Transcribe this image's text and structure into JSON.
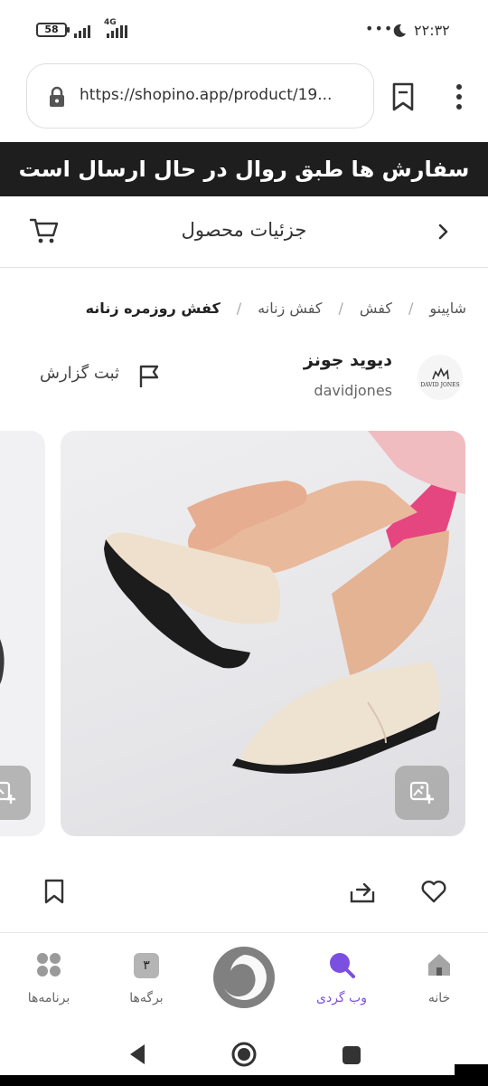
{
  "status_bar": {
    "battery": "58",
    "network": "4G",
    "time": "۲۲:۳۲",
    "dots": "•••"
  },
  "browser": {
    "url": "https://shopino.app/product/19..."
  },
  "banner": {
    "text": "سفارش ها طبق روال در حال ارسال است"
  },
  "header": {
    "title": "جزئیات محصول"
  },
  "breadcrumb": {
    "items": [
      "شاپینو",
      "کفش",
      "کفش زنانه",
      "کفش روزمره زنانه"
    ],
    "separator": "/"
  },
  "brand": {
    "name": "دیوید جونز",
    "handle": "davidjones",
    "logo_text": "DAVID JONES"
  },
  "report": {
    "label": "ثبت گزارش"
  },
  "bottom_nav": {
    "items": [
      {
        "label": "برنامه‌ها",
        "icon": "apps-icon"
      },
      {
        "label": "برگه‌ها",
        "icon": "tabs-icon",
        "badge": "۳"
      },
      {
        "label": "",
        "icon": "logo-icon"
      },
      {
        "label": "وب گردی",
        "icon": "search-icon"
      },
      {
        "label": "خانه",
        "icon": "home-icon"
      }
    ]
  },
  "colors": {
    "accent": "#7b4fe0",
    "banner_bg": "#1e1e1e"
  }
}
